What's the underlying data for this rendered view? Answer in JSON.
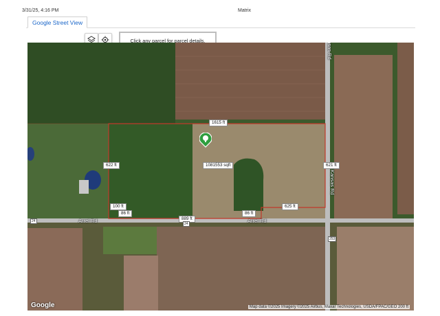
{
  "header": {
    "datetime": "3/31/25, 4:16 PM",
    "title": "Matrix"
  },
  "tabs": [
    {
      "label": "Google Street View"
    }
  ],
  "map": {
    "info_box": "Click any parcel for parcel details.",
    "dimensions": {
      "top": "1615 ft",
      "area": "1081553 sqft",
      "left": "622 ft",
      "right": "621 ft",
      "bl1": "100 ft",
      "bl2": "86 ft",
      "bottom": "889 ft",
      "br1": "86 ft",
      "br2": "625 ft"
    },
    "roads": {
      "arrel_left": "Arrel Rd",
      "arrel_right": "Arrel Rd",
      "kansas": "Kansas Rd",
      "kansas_top": "Kansas Rd",
      "route_left": "24",
      "route_mid": "24",
      "route_right": "253"
    },
    "attribution": "Map data ©2025 Imagery ©2025 Airbus, Maxar Technologies, USDA/FPAC/GEO",
    "scale": "200 ft",
    "google_logo": "Google",
    "icons": [
      "layers-icon",
      "locate-icon",
      "parcel-marker-icon"
    ]
  }
}
